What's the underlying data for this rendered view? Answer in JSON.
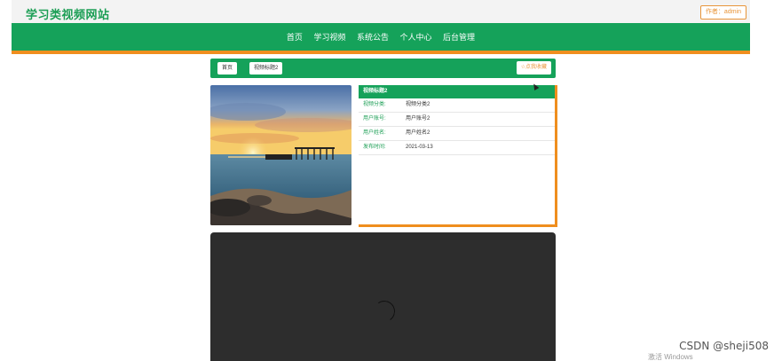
{
  "header": {
    "site_title": "学习类视频网站",
    "author_badge": "作者：admin"
  },
  "nav": {
    "items": [
      "首页",
      "学习视频",
      "系统公告",
      "个人中心",
      "后台管理"
    ]
  },
  "breadcrumb": {
    "home": "首页",
    "current": "视频标题2",
    "favorite_button": "☆点我收藏"
  },
  "info_panel": {
    "title": "视频标题2",
    "rows": [
      {
        "label": "视频分类:",
        "value": "视频分类2"
      },
      {
        "label": "用户账号:",
        "value": "用户账号2"
      },
      {
        "label": "用户姓名:",
        "value": "用户姓名2"
      },
      {
        "label": "发布时间:",
        "value": "2021-03-13"
      }
    ]
  },
  "overlay": {
    "csdn": "CSDN @sheji508",
    "windows": "激活 Windows"
  },
  "colors": {
    "primary_green": "#15a25a",
    "accent_orange": "#ef8e1e"
  }
}
